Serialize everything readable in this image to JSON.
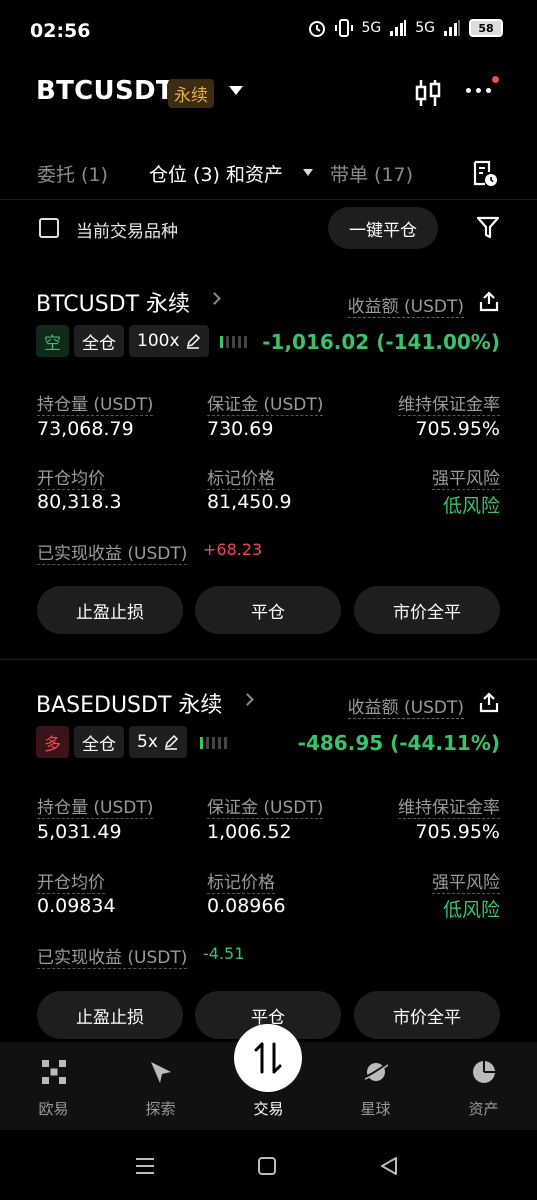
{
  "status_bar": {
    "time": "02:56",
    "battery": "58",
    "net1": "5G",
    "net2": "5G"
  },
  "header": {
    "title": "BTCUSDT",
    "badge": "永续"
  },
  "tabs": [
    {
      "label": "委托 (1)",
      "active": false
    },
    {
      "label": "仓位 (3) 和资产",
      "active": true
    },
    {
      "label": "带单 (17)",
      "active": false
    }
  ],
  "filter": {
    "current_only_label": "当前交易品种",
    "close_all_label": "一键平仓"
  },
  "positions": [
    {
      "symbol": "BTCUSDT 永续",
      "pnl_label": "收益额 (USDT)",
      "side": "空",
      "margin_mode": "全仓",
      "leverage": "100x",
      "risk_level_bars": 1,
      "pnl": "-1,016.02 (-141.00%)",
      "size_label": "持仓量 (USDT)",
      "size": "73,068.79",
      "margin_label": "保证金 (USDT)",
      "margin": "730.69",
      "mmr_label": "维持保证金率",
      "mmr": "705.95%",
      "entry_label": "开仓均价",
      "entry": "80,318.3",
      "mark_label": "标记价格",
      "mark": "81,450.9",
      "risk_label": "强平风险",
      "risk": "低风险",
      "realized_label": "已实现收益 (USDT)",
      "realized": "+68.23",
      "btn_tpsl": "止盈止损",
      "btn_close": "平仓",
      "btn_market_close": "市价全平"
    },
    {
      "symbol": "BASEDUSDT 永续",
      "pnl_label": "收益额 (USDT)",
      "side": "多",
      "margin_mode": "全仓",
      "leverage": "5x",
      "risk_level_bars": 1,
      "pnl": "-486.95 (-44.11%)",
      "size_label": "持仓量 (USDT)",
      "size": "5,031.49",
      "margin_label": "保证金 (USDT)",
      "margin": "1,006.52",
      "mmr_label": "维持保证金率",
      "mmr": "705.95%",
      "entry_label": "开仓均价",
      "entry": "0.09834",
      "mark_label": "标记价格",
      "mark": "0.08966",
      "risk_label": "强平风险",
      "risk": "低风险",
      "realized_label": "已实现收益 (USDT)",
      "realized": "-4.51",
      "btn_tpsl": "止盈止损",
      "btn_close": "平仓",
      "btn_market_close": "市价全平"
    }
  ],
  "bottom_nav": [
    {
      "label": "欧易",
      "icon": "okx-logo-icon"
    },
    {
      "label": "探索",
      "icon": "compass-icon"
    },
    {
      "label": "交易",
      "icon": "trade-arrows-icon",
      "active": true
    },
    {
      "label": "星球",
      "icon": "planet-icon"
    },
    {
      "label": "资产",
      "icon": "pie-chart-icon"
    }
  ],
  "colors": {
    "up": "#39c26a",
    "down": "#f04a5a",
    "badge_text": "#e8b04a",
    "background": "#000000"
  }
}
